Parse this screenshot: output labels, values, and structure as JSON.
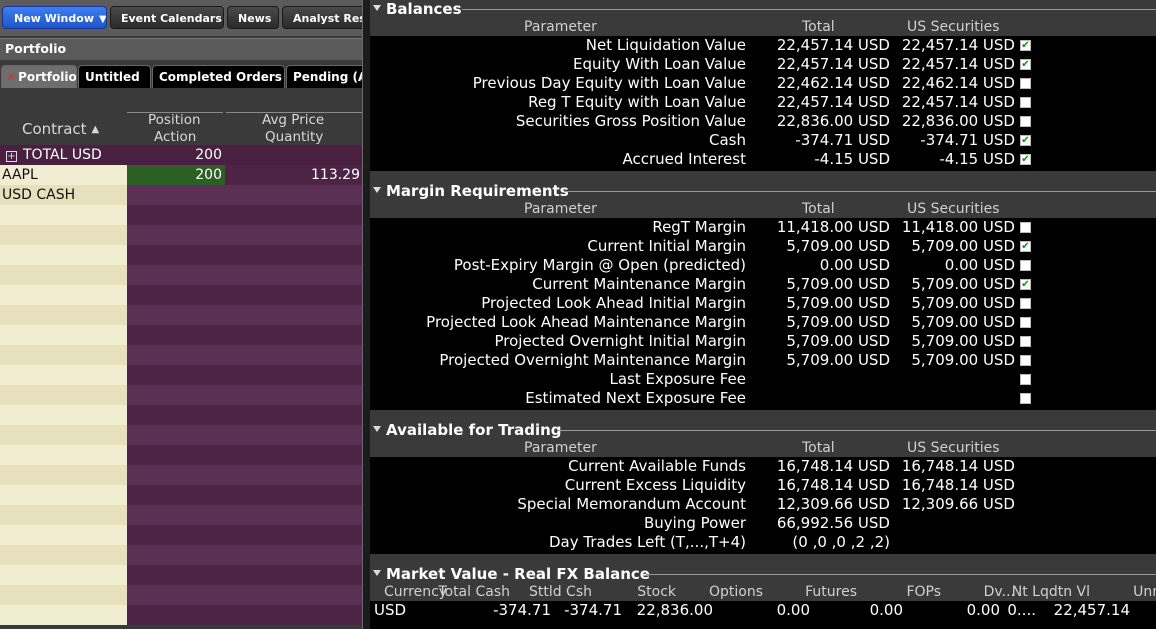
{
  "toolbar": {
    "new_window": "New Window",
    "event_calendars": "Event Calendars",
    "news": "News",
    "analyst_research": "Analyst Rese"
  },
  "portfolio": {
    "title": "Portfolio",
    "tabs": [
      "Portfolio",
      "Untitled",
      "Completed Orders",
      "Pending (All"
    ],
    "headers": {
      "contract": "Contract",
      "position": "Position",
      "action": "Action",
      "avg_price": "Avg Price",
      "quantity": "Quantity"
    },
    "rows": [
      {
        "contract": "TOTAL   USD",
        "position": "200",
        "avg_price": ""
      },
      {
        "contract": "AAPL",
        "position": "200",
        "avg_price": "113.29"
      },
      {
        "contract": "USD CASH",
        "position": "",
        "avg_price": ""
      }
    ]
  },
  "column_headers": {
    "parameter": "Parameter",
    "total": "Total",
    "us_securities": "US Securities"
  },
  "balances": {
    "title": "Balances",
    "rows": [
      {
        "name": "Net Liquidation Value",
        "total": "22,457.14 USD",
        "us": "22,457.14 USD",
        "checked": true
      },
      {
        "name": "Equity With Loan Value",
        "total": "22,457.14 USD",
        "us": "22,457.14 USD",
        "checked": true
      },
      {
        "name": "Previous Day Equity with Loan Value",
        "total": "22,462.14 USD",
        "us": "22,462.14 USD",
        "checked": false
      },
      {
        "name": "Reg T Equity with Loan Value",
        "total": "22,457.14 USD",
        "us": "22,457.14 USD",
        "checked": false
      },
      {
        "name": "Securities Gross Position Value",
        "total": "22,836.00 USD",
        "us": "22,836.00 USD",
        "checked": false
      },
      {
        "name": "Cash",
        "total": "-374.71 USD",
        "us": "-374.71 USD",
        "checked": true
      },
      {
        "name": "Accrued Interest",
        "total": "-4.15 USD",
        "us": "-4.15 USD",
        "checked": true
      }
    ]
  },
  "margin": {
    "title": "Margin Requirements",
    "rows": [
      {
        "name": "RegT Margin",
        "total": "11,418.00 USD",
        "us": "11,418.00 USD",
        "checked": false
      },
      {
        "name": "Current Initial Margin",
        "total": "5,709.00 USD",
        "us": "5,709.00 USD",
        "checked": true
      },
      {
        "name": "Post-Expiry Margin @ Open (predicted)",
        "total": "0.00 USD",
        "us": "0.00 USD",
        "checked": false
      },
      {
        "name": "Current Maintenance Margin",
        "total": "5,709.00 USD",
        "us": "5,709.00 USD",
        "checked": true
      },
      {
        "name": "Projected Look Ahead Initial Margin",
        "total": "5,709.00 USD",
        "us": "5,709.00 USD",
        "checked": false
      },
      {
        "name": "Projected Look Ahead Maintenance Margin",
        "total": "5,709.00 USD",
        "us": "5,709.00 USD",
        "checked": false
      },
      {
        "name": "Projected Overnight Initial Margin",
        "total": "5,709.00 USD",
        "us": "5,709.00 USD",
        "checked": false
      },
      {
        "name": "Projected Overnight Maintenance Margin",
        "total": "5,709.00 USD",
        "us": "5,709.00 USD",
        "checked": false
      },
      {
        "name": "Last Exposure Fee",
        "total": "",
        "us": "",
        "checked": false
      },
      {
        "name": "Estimated Next Exposure Fee",
        "total": "",
        "us": "",
        "checked": false
      }
    ]
  },
  "trading": {
    "title": "Available for Trading",
    "rows": [
      {
        "name": "Current Available Funds",
        "total": "16,748.14 USD",
        "us": "16,748.14 USD"
      },
      {
        "name": "Current Excess Liquidity",
        "total": "16,748.14 USD",
        "us": "16,748.14 USD"
      },
      {
        "name": "Special Memorandum Account",
        "total": "12,309.66 USD",
        "us": "12,309.66 USD"
      },
      {
        "name": "Buying Power",
        "total": "66,992.56 USD",
        "us": ""
      },
      {
        "name": "Day Trades Left (T,...,T+4)",
        "total": "(0 ,0 ,0 ,2 ,2)",
        "us": ""
      }
    ]
  },
  "market": {
    "title": "Market Value - Real FX Balance",
    "headers": [
      "Currency",
      "Total Cash",
      "Sttld Csh",
      "Stock",
      "Options",
      "Futures",
      "FOPs",
      "Dv...",
      "Nt Lqdtn Vl",
      "Unr"
    ],
    "row": [
      "USD",
      "-374.71",
      "-374.71",
      "22,836.00",
      "0.00",
      "0.00",
      "0.00",
      "0....",
      "22,457.14",
      ""
    ]
  }
}
